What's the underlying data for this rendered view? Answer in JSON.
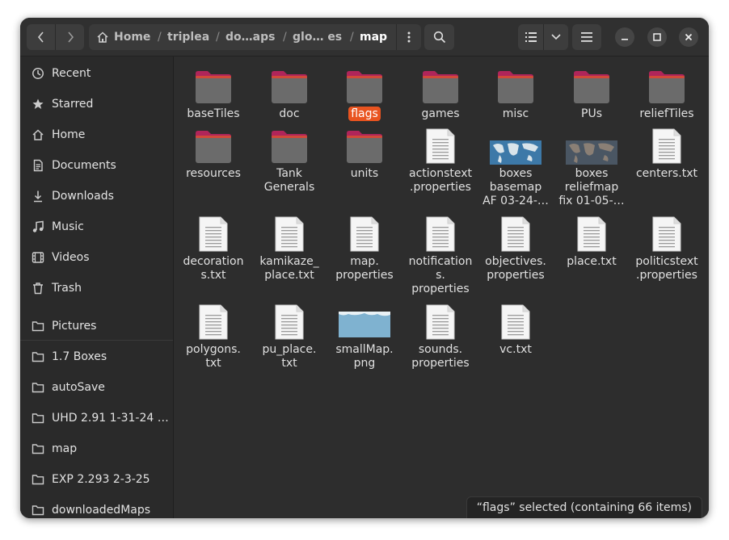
{
  "breadcrumbs": [
    "Home",
    "triplea",
    "do…aps",
    "glo… es",
    "map"
  ],
  "sidebar": {
    "places": [
      {
        "label": "Recent",
        "icon": "clock-icon"
      },
      {
        "label": "Starred",
        "icon": "star-icon"
      },
      {
        "label": "Home",
        "icon": "home-icon"
      },
      {
        "label": "Documents",
        "icon": "document-icon"
      },
      {
        "label": "Downloads",
        "icon": "download-icon"
      },
      {
        "label": "Music",
        "icon": "music-icon"
      },
      {
        "label": "Videos",
        "icon": "video-icon"
      },
      {
        "label": "Trash",
        "icon": "trash-icon"
      }
    ],
    "bookmarks": [
      {
        "label": "Pictures",
        "icon": "folder-icon"
      },
      {
        "label": "1.7 Boxes",
        "icon": "folder-icon"
      },
      {
        "label": "autoSave",
        "icon": "folder-icon"
      },
      {
        "label": "UHD 2.91 1-31-24 …",
        "icon": "folder-icon"
      },
      {
        "label": "map",
        "icon": "folder-icon"
      },
      {
        "label": "EXP 2.293 2-3-25",
        "icon": "folder-icon"
      },
      {
        "label": "downloadedMaps",
        "icon": "folder-icon"
      }
    ]
  },
  "files": [
    {
      "name": "baseTiles",
      "type": "folder"
    },
    {
      "name": "doc",
      "type": "folder"
    },
    {
      "name": "flags",
      "type": "folder",
      "selected": true
    },
    {
      "name": "games",
      "type": "folder"
    },
    {
      "name": "misc",
      "type": "folder"
    },
    {
      "name": "PUs",
      "type": "folder"
    },
    {
      "name": "reliefTiles",
      "type": "folder"
    },
    {
      "name": "resources",
      "type": "folder"
    },
    {
      "name": "Tank\nGenerals",
      "type": "folder"
    },
    {
      "name": "units",
      "type": "folder"
    },
    {
      "name": "actionstext\n.properties",
      "type": "text"
    },
    {
      "name": "boxes\nbasemap\nAF 03-24-…",
      "type": "image-map"
    },
    {
      "name": "boxes\nreliefmap\nfix 01-05-…",
      "type": "image-relief"
    },
    {
      "name": "centers.txt",
      "type": "text"
    },
    {
      "name": "decoration\ns.txt",
      "type": "text"
    },
    {
      "name": "kamikaze_\nplace.txt",
      "type": "text"
    },
    {
      "name": "map.\nproperties",
      "type": "text"
    },
    {
      "name": "notification\ns.\nproperties",
      "type": "text"
    },
    {
      "name": "objectives.\nproperties",
      "type": "text"
    },
    {
      "name": "place.txt",
      "type": "text"
    },
    {
      "name": "politicstext\n.properties",
      "type": "text"
    },
    {
      "name": "polygons.\ntxt",
      "type": "text"
    },
    {
      "name": "pu_place.\ntxt",
      "type": "text"
    },
    {
      "name": "smallMap.\npng",
      "type": "image-small"
    },
    {
      "name": "sounds.\nproperties",
      "type": "text"
    },
    {
      "name": "vc.txt",
      "type": "text"
    }
  ],
  "status": "“flags” selected  (containing 66 items)",
  "colors": {
    "accent": "#e95420",
    "folder_tab": "#b0255a",
    "folder_body": "#6b6b6b"
  }
}
